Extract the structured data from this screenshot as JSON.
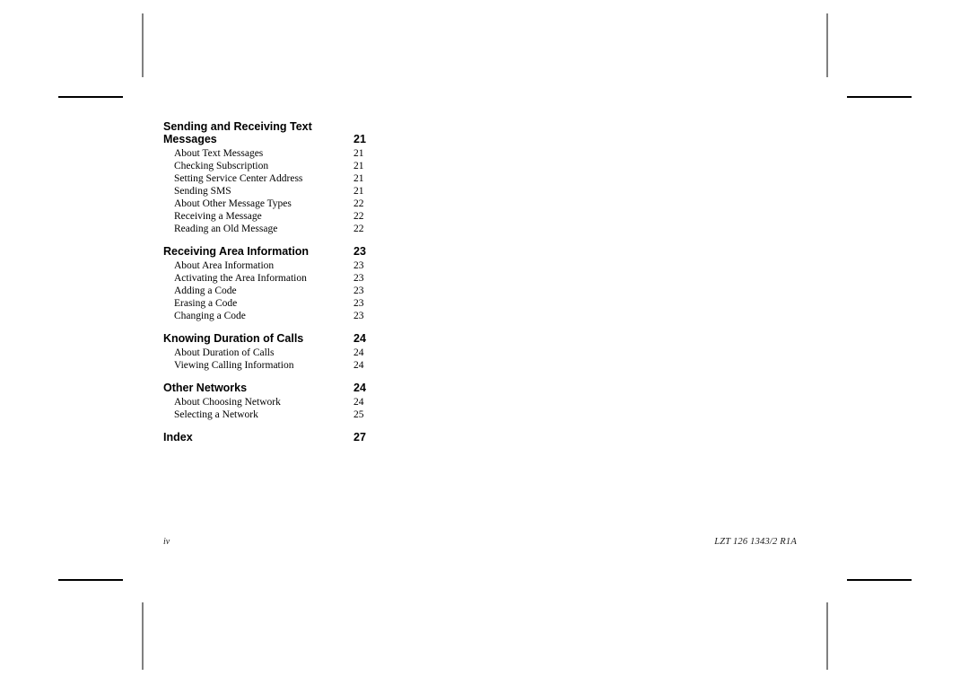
{
  "document": {
    "footer": {
      "page_number": "iv",
      "doc_code": "LZT 126 1343/2 R1A"
    }
  },
  "toc": {
    "sections": [
      {
        "heading": "Sending and Receiving Text Messages",
        "page": "21",
        "entries": [
          {
            "title": "About Text Messages",
            "page": "21"
          },
          {
            "title": "Checking Subscription",
            "page": "21"
          },
          {
            "title": "Setting Service Center Address",
            "page": "21"
          },
          {
            "title": "Sending SMS",
            "page": "21"
          },
          {
            "title": "About Other Message Types",
            "page": "22"
          },
          {
            "title": "Receiving a Message",
            "page": "22"
          },
          {
            "title": "Reading an Old Message",
            "page": "22"
          }
        ]
      },
      {
        "heading": "Receiving Area Information",
        "page": "23",
        "entries": [
          {
            "title": "About Area Information",
            "page": "23"
          },
          {
            "title": "Activating the Area Information",
            "page": "23"
          },
          {
            "title": "Adding a Code",
            "page": "23"
          },
          {
            "title": "Erasing a Code",
            "page": "23"
          },
          {
            "title": "Changing a Code",
            "page": "23"
          }
        ]
      },
      {
        "heading": "Knowing Duration of Calls",
        "page": "24",
        "entries": [
          {
            "title": "About Duration of Calls",
            "page": "24"
          },
          {
            "title": "Viewing Calling Information",
            "page": "24"
          }
        ]
      },
      {
        "heading": "Other Networks",
        "page": "24",
        "entries": [
          {
            "title": "About Choosing Network",
            "page": "24"
          },
          {
            "title": "Selecting a Network",
            "page": "25"
          }
        ]
      },
      {
        "heading": "Index",
        "page": "27",
        "entries": []
      }
    ]
  }
}
